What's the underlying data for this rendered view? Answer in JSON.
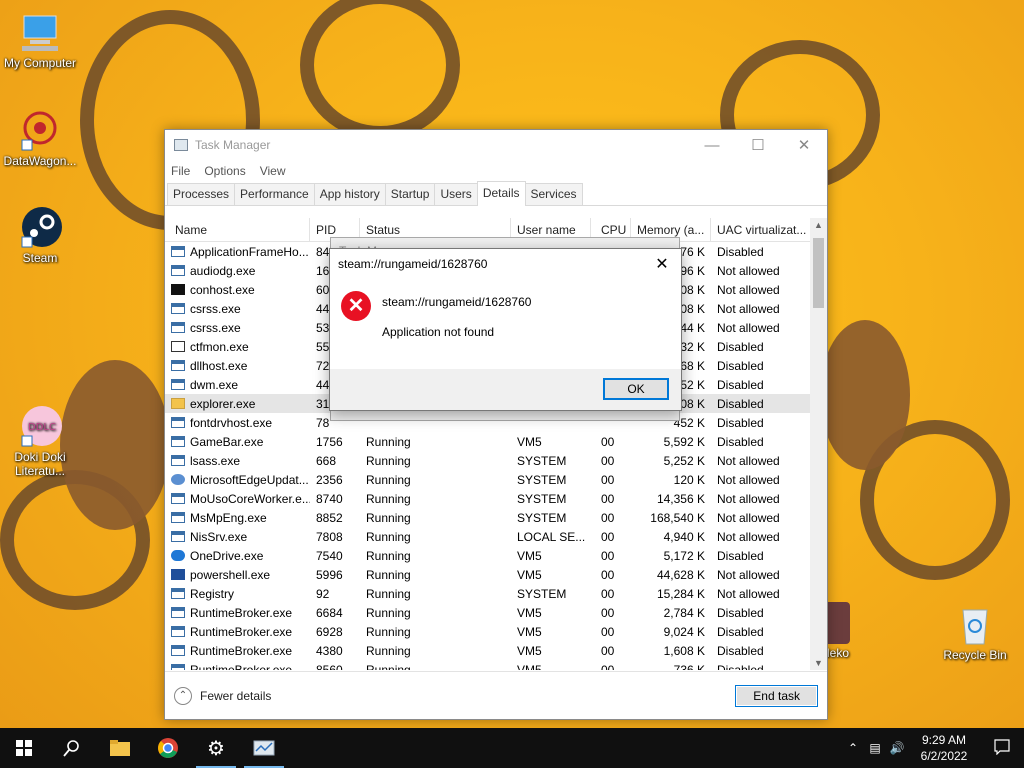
{
  "desktop": {
    "icons": [
      {
        "label": "My Computer"
      },
      {
        "label": "DataWagon..."
      },
      {
        "label": "Steam"
      },
      {
        "label": "Doki Doki Literatu..."
      },
      {
        "label": "Recycle Bin"
      },
      {
        "label": "Neko"
      }
    ]
  },
  "taskmanager": {
    "title": "Task Manager",
    "menu": [
      "File",
      "Options",
      "View"
    ],
    "tabs": [
      "Processes",
      "Performance",
      "App history",
      "Startup",
      "Users",
      "Details",
      "Services"
    ],
    "active_tab": "Details",
    "columns": [
      "Name",
      "PID",
      "Status",
      "User name",
      "CPU",
      "Memory (a...",
      "UAC virtualizat..."
    ],
    "rows": [
      {
        "name": "ApplicationFrameHo...",
        "pid": "84",
        "status": "",
        "user": "",
        "cpu": "",
        "mem": "76 K",
        "uac": "Disabled",
        "icon": "app"
      },
      {
        "name": "audiodg.exe",
        "pid": "16",
        "status": "",
        "user": "",
        "cpu": "",
        "mem": "96 K",
        "uac": "Not allowed",
        "icon": "app"
      },
      {
        "name": "conhost.exe",
        "pid": "60",
        "status": "",
        "user": "",
        "cpu": "",
        "mem": "08 K",
        "uac": "Not allowed",
        "icon": "cmd"
      },
      {
        "name": "csrss.exe",
        "pid": "44",
        "status": "",
        "user": "",
        "cpu": "",
        "mem": "08 K",
        "uac": "Not allowed",
        "icon": "app"
      },
      {
        "name": "csrss.exe",
        "pid": "53",
        "status": "",
        "user": "",
        "cpu": "",
        "mem": "44 K",
        "uac": "Not allowed",
        "icon": "app"
      },
      {
        "name": "ctfmon.exe",
        "pid": "55",
        "status": "",
        "user": "",
        "cpu": "",
        "mem": "32 K",
        "uac": "Disabled",
        "icon": "pen"
      },
      {
        "name": "dllhost.exe",
        "pid": "72",
        "status": "",
        "user": "",
        "cpu": "",
        "mem": "68 K",
        "uac": "Disabled",
        "icon": "app"
      },
      {
        "name": "dwm.exe",
        "pid": "44",
        "status": "",
        "user": "",
        "cpu": "",
        "mem": "52 K",
        "uac": "Disabled",
        "icon": "app"
      },
      {
        "name": "explorer.exe",
        "pid": "31",
        "status": "",
        "user": "",
        "cpu": "",
        "mem": "08 K",
        "uac": "Disabled",
        "icon": "folder"
      },
      {
        "name": "fontdrvhost.exe",
        "pid": "78",
        "status": "",
        "user": "",
        "cpu": "",
        "mem": "452 K",
        "uac": "Disabled",
        "icon": "app"
      },
      {
        "name": "GameBar.exe",
        "pid": "1756",
        "status": "Running",
        "user": "VM5",
        "cpu": "00",
        "mem": "5,592 K",
        "uac": "Disabled",
        "icon": "app"
      },
      {
        "name": "lsass.exe",
        "pid": "668",
        "status": "Running",
        "user": "SYSTEM",
        "cpu": "00",
        "mem": "5,252 K",
        "uac": "Not allowed",
        "icon": "app"
      },
      {
        "name": "MicrosoftEdgeUpdat...",
        "pid": "2356",
        "status": "Running",
        "user": "SYSTEM",
        "cpu": "00",
        "mem": "120 K",
        "uac": "Not allowed",
        "icon": "gear"
      },
      {
        "name": "MoUsoCoreWorker.e...",
        "pid": "8740",
        "status": "Running",
        "user": "SYSTEM",
        "cpu": "00",
        "mem": "14,356 K",
        "uac": "Not allowed",
        "icon": "app"
      },
      {
        "name": "MsMpEng.exe",
        "pid": "8852",
        "status": "Running",
        "user": "SYSTEM",
        "cpu": "00",
        "mem": "168,540 K",
        "uac": "Not allowed",
        "icon": "app"
      },
      {
        "name": "NisSrv.exe",
        "pid": "7808",
        "status": "Running",
        "user": "LOCAL SE...",
        "cpu": "00",
        "mem": "4,940 K",
        "uac": "Not allowed",
        "icon": "app"
      },
      {
        "name": "OneDrive.exe",
        "pid": "7540",
        "status": "Running",
        "user": "VM5",
        "cpu": "00",
        "mem": "5,172 K",
        "uac": "Disabled",
        "icon": "cloud"
      },
      {
        "name": "powershell.exe",
        "pid": "5996",
        "status": "Running",
        "user": "VM5",
        "cpu": "00",
        "mem": "44,628 K",
        "uac": "Not allowed",
        "icon": "ps"
      },
      {
        "name": "Registry",
        "pid": "92",
        "status": "Running",
        "user": "SYSTEM",
        "cpu": "00",
        "mem": "15,284 K",
        "uac": "Not allowed",
        "icon": "app"
      },
      {
        "name": "RuntimeBroker.exe",
        "pid": "6684",
        "status": "Running",
        "user": "VM5",
        "cpu": "00",
        "mem": "2,784 K",
        "uac": "Disabled",
        "icon": "app"
      },
      {
        "name": "RuntimeBroker.exe",
        "pid": "6928",
        "status": "Running",
        "user": "VM5",
        "cpu": "00",
        "mem": "9,024 K",
        "uac": "Disabled",
        "icon": "app"
      },
      {
        "name": "RuntimeBroker.exe",
        "pid": "4380",
        "status": "Running",
        "user": "VM5",
        "cpu": "00",
        "mem": "1,608 K",
        "uac": "Disabled",
        "icon": "app"
      },
      {
        "name": "RuntimeBroker.exe",
        "pid": "8560",
        "status": "Running",
        "user": "VM5",
        "cpu": "00",
        "mem": "736 K",
        "uac": "Disabled",
        "icon": "app"
      }
    ],
    "selected_row": 8,
    "fewer_details": "Fewer details",
    "end_task": "End task"
  },
  "dialog": {
    "title": "steam://rungameid/1628760",
    "message": "steam://rungameid/1628760",
    "detail": "Application not found",
    "ok": "OK",
    "icon": "error-icon",
    "behind_title": "Task Manager"
  },
  "taskbar": {
    "time": "9:29 AM",
    "date": "6/2/2022",
    "apps": [
      "start",
      "search",
      "file-explorer",
      "chrome",
      "settings",
      "task-manager"
    ]
  },
  "colors": {
    "accent": "#0078d7",
    "error": "#e81123",
    "wallpaper": "#f7b21a"
  }
}
